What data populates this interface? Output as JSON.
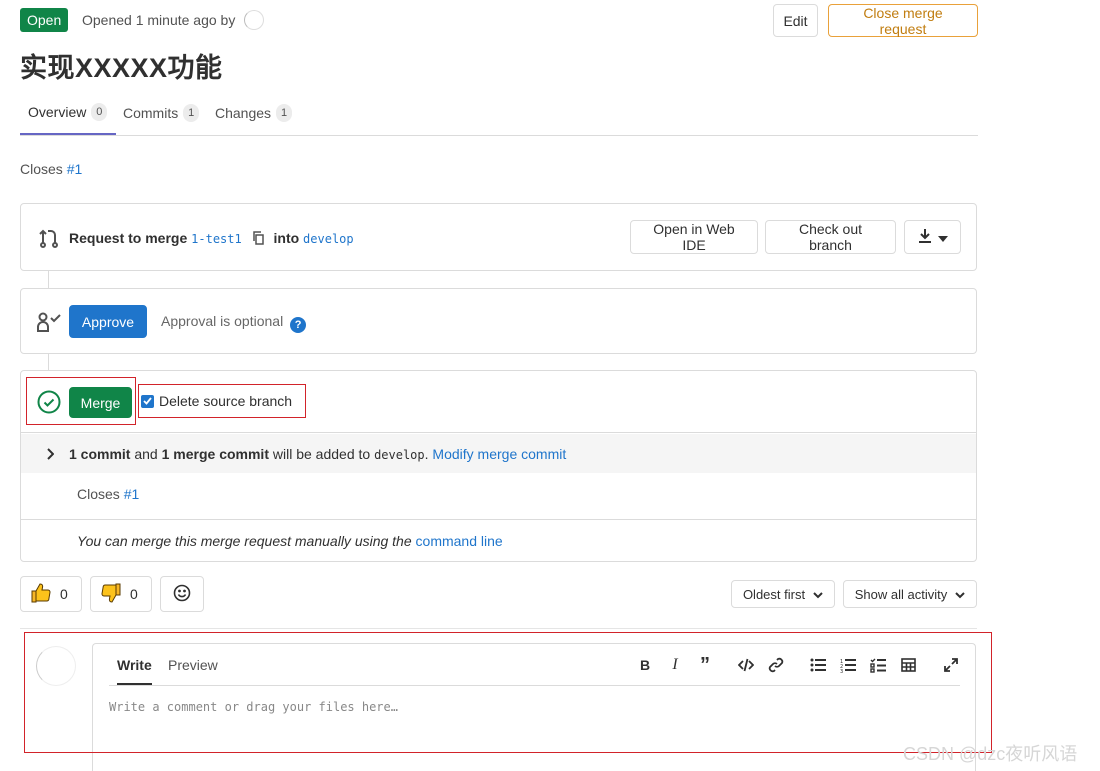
{
  "header": {
    "status": "Open",
    "opened_text": "Opened 1 minute ago by",
    "edit_label": "Edit",
    "close_label": "Close merge request"
  },
  "title": "实现XXXXX功能",
  "tabs": [
    {
      "label": "Overview",
      "count": "0"
    },
    {
      "label": "Commits",
      "count": "1"
    },
    {
      "label": "Changes",
      "count": "1"
    }
  ],
  "description": {
    "closes_text": "Closes",
    "closes_ref": "#1"
  },
  "request": {
    "prefix": "Request to merge",
    "source_branch": "1-test1",
    "into": "into",
    "target_branch": "develop",
    "web_ide_label": "Open in Web IDE",
    "checkout_label": "Check out branch"
  },
  "approval": {
    "button_label": "Approve",
    "text": "Approval is optional"
  },
  "merge": {
    "button_label": "Merge",
    "delete_source_label": "Delete source branch",
    "delete_source_checked": true,
    "commits_count": "1 commit",
    "and": "and",
    "merge_commit": "1 merge commit",
    "added_to": "will be added to",
    "target": "develop",
    "modify_label": "Modify merge commit",
    "closes_text": "Closes",
    "closes_ref": "#1",
    "manual_text": "You can merge this merge request manually using the",
    "command_line_label": "command line"
  },
  "reactions": {
    "thumbs_up": "0",
    "thumbs_down": "0"
  },
  "sort": {
    "order_label": "Oldest first",
    "filter_label": "Show all activity"
  },
  "comment": {
    "write_tab": "Write",
    "preview_tab": "Preview",
    "placeholder": "Write a comment or drag your files here…"
  },
  "watermark": "CSDN @dzc夜听风语",
  "colors": {
    "green": "#108548",
    "blue": "#1f75cb",
    "orange": "#e9a13a",
    "highlight_red": "#d2232a"
  }
}
